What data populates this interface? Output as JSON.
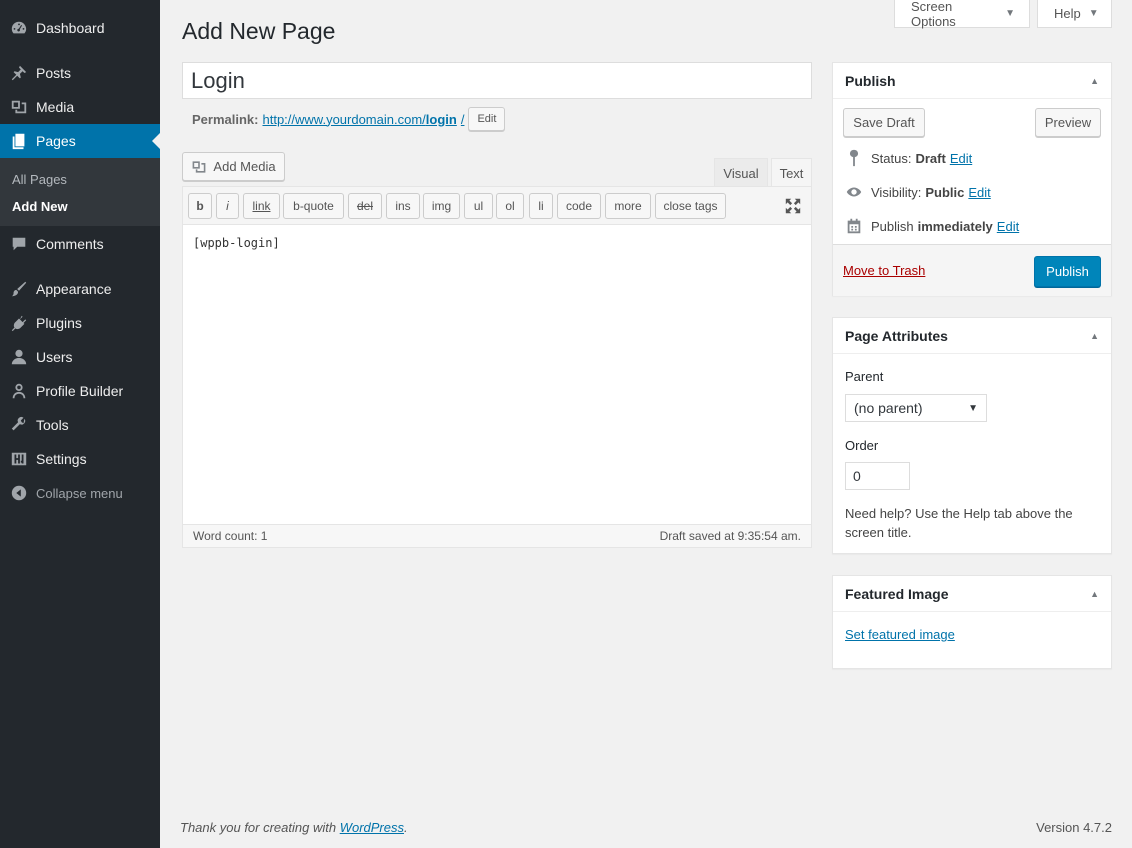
{
  "sidebar": {
    "items": [
      {
        "label": "Dashboard",
        "icon": "dashboard-icon"
      },
      {
        "label": "Posts",
        "icon": "pin-icon"
      },
      {
        "label": "Media",
        "icon": "media-icon"
      },
      {
        "label": "Pages",
        "icon": "pages-icon"
      },
      {
        "label": "Comments",
        "icon": "comments-icon"
      },
      {
        "label": "Appearance",
        "icon": "brush-icon"
      },
      {
        "label": "Plugins",
        "icon": "plug-icon"
      },
      {
        "label": "Users",
        "icon": "users-icon"
      },
      {
        "label": "Profile Builder",
        "icon": "profile-icon"
      },
      {
        "label": "Tools",
        "icon": "wrench-icon"
      },
      {
        "label": "Settings",
        "icon": "settings-icon"
      }
    ],
    "submenu": {
      "all_pages": "All Pages",
      "add_new": "Add New"
    },
    "collapse": "Collapse menu"
  },
  "top_tabs": {
    "screen_options": "Screen Options",
    "help": "Help"
  },
  "page_title": "Add New Page",
  "post_title": "Login",
  "permalink": {
    "label": "Permalink:",
    "url_prefix": "http://www.yourdomain.com/",
    "slug": "login",
    "url_suffix": "/",
    "edit": "Edit"
  },
  "editor": {
    "add_media": "Add Media",
    "tab_visual": "Visual",
    "tab_text": "Text",
    "quicktags": [
      "b",
      "i",
      "link",
      "b-quote",
      "del",
      "ins",
      "img",
      "ul",
      "ol",
      "li",
      "code",
      "more",
      "close tags"
    ],
    "content": "[wppb-login]",
    "word_count": "Word count: 1",
    "draft_saved": "Draft saved at 9:35:54 am."
  },
  "publish_box": {
    "title": "Publish",
    "save_draft": "Save Draft",
    "preview": "Preview",
    "status_label": "Status:",
    "status_value": "Draft",
    "visibility_label": "Visibility:",
    "visibility_value": "Public",
    "publish_label": "Publish",
    "publish_value": "immediately",
    "edit": "Edit",
    "trash": "Move to Trash",
    "publish_button": "Publish"
  },
  "page_attributes": {
    "title": "Page Attributes",
    "parent_label": "Parent",
    "parent_value": "(no parent)",
    "order_label": "Order",
    "order_value": "0",
    "help": "Need help? Use the Help tab above the screen title."
  },
  "featured_image": {
    "title": "Featured Image",
    "link": "Set featured image"
  },
  "footer": {
    "thanks_prefix": "Thank you for creating with",
    "wordpress": "WordPress",
    "thanks_suffix": ".",
    "version": "Version 4.7.2"
  },
  "colors": {
    "accent": "#0073aa",
    "primary_button": "#0085ba",
    "sidebar_bg": "#23282d",
    "trash": "#a00"
  }
}
